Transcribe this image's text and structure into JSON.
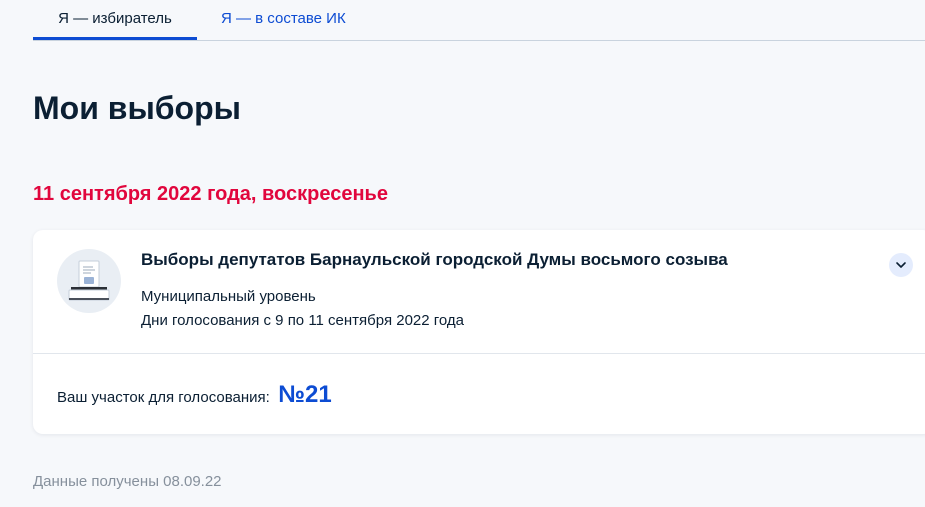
{
  "tabs": {
    "voter": "Я — избиратель",
    "commission": "Я — в составе ИК"
  },
  "page": {
    "title": "Мои выборы"
  },
  "election_date": "11 сентября 2022 года, воскресенье",
  "election": {
    "title": "Выборы депутатов Барнаульской городской Думы восьмого созыва",
    "level": "Муниципальный уровень",
    "voting_days": "Дни голосования с 9 по 11 сентября 2022 года",
    "precinct_label": "Ваш участок для голосования:",
    "precinct_number": "№21",
    "icon": "ballot-box-icon"
  },
  "footer": {
    "data_received": "Данные получены 08.09.22"
  },
  "colors": {
    "accent": "#0d4cd3",
    "date_red": "#e1063d",
    "text": "#0b1f33",
    "muted": "#86909c",
    "background": "#f6f8fb"
  }
}
